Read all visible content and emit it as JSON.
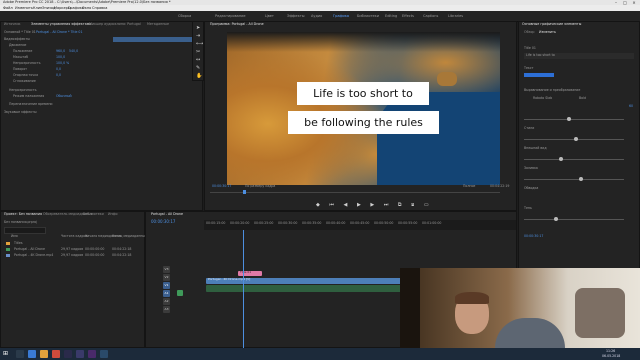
{
  "window": {
    "title": "Adobe Premiere Pro CC 2018 - C:\\Users\\...\\Documents\\Adobe\\Premiere Pro\\12.0\\Без названия *"
  },
  "menu": [
    "Файл",
    "Изменить",
    "Клип",
    "Эпизод",
    "Маркеры",
    "Графика",
    "Окно",
    "Справка"
  ],
  "workspaces": {
    "items": [
      "Сборка",
      "Редактирование",
      "Цвет",
      "Эффекты",
      "Аудио",
      "Графика",
      "Библиотеки",
      "Editing",
      "Effects",
      "Captions",
      "Libraries"
    ],
    "active_index": 5
  },
  "left_panel": {
    "tabs": [
      "Элементы управления эффектами",
      "Микшер аудиоклипа: Portugal",
      "Метаданные"
    ],
    "source": "Основной * Title 01",
    "clip": "Portugal - All Drone * Title 01",
    "section": "Видеоэффекты",
    "rows": [
      "Движение",
      "Положение",
      "Масштаб",
      "Непрозрачность",
      "Поворот",
      "Опорная точка",
      "Сглаживание",
      "Непрозрачность",
      "Режим наложения",
      "Переназначение времени",
      "Звуковые эффекты"
    ],
    "values": [
      "960,0",
      "540,0",
      "100,0",
      "100,0 %",
      "0,0",
      "0,0",
      "Обычный"
    ]
  },
  "program_monitor": {
    "tab": "Программа: Portugal - All Drone",
    "timecode_left": "00:00:30:17",
    "fit": "По размеру кадра",
    "quality": "Полное",
    "timecode_right": "00:04:22:19"
  },
  "lower_third": {
    "line1": "Life is too short to",
    "line2": "be following the rules"
  },
  "project_panel": {
    "tabs": [
      "Проект: Без названия",
      "Обозреватель медиаданных",
      "Библиотеки",
      "Инфо"
    ],
    "name": "Без названия.prproj",
    "columns": [
      "Имя",
      "Частота кадров",
      "Начало медиаданных",
      "Конец медиаданных"
    ],
    "items": [
      {
        "name": "Portugal - All Drone",
        "fps": "29,97 кадров",
        "start": "00:00:00:00",
        "end": "00:04:22:18"
      },
      {
        "name": "Portugal - 4K Drone.mp4",
        "fps": "29,97 кадров",
        "start": "00:00:00:00",
        "end": "00:04:22:18"
      },
      {
        "name": "Titles",
        "fps": "",
        "start": "",
        "end": ""
      }
    ]
  },
  "timeline": {
    "tab": "Portugal - All Drone",
    "timecode": "00:00:30:17",
    "ruler": [
      "00:00:15:00",
      "00:00:20:00",
      "00:00:25:00",
      "00:00:30:00",
      "00:00:35:00",
      "00:00:40:00",
      "00:00:45:00",
      "00:00:50:00",
      "00:00:55:00",
      "00:01:00:00"
    ],
    "tracks": [
      "V3",
      "V2",
      "V1",
      "A1",
      "A2",
      "A3"
    ],
    "clip_v2": "Title 01",
    "clip_v1": "Portugal - 4K Drone.mp4 [V]"
  },
  "essential_graphics": {
    "tabs": [
      "Основные графические элементы",
      "Обзор",
      "Изменить"
    ],
    "title": "Title 01",
    "layer": "Life is too short to",
    "section": "Текст",
    "font": "Roboto Slab",
    "style": "Bold",
    "size": "60",
    "labels": [
      "Выравнивание и преобразование",
      "Стили",
      "Внешний вид",
      "Заливка",
      "Обводка",
      "Тень"
    ],
    "timecode": "00:00:30:17"
  },
  "taskbar": {
    "clock": "11:26",
    "date": "06.05.2018"
  },
  "colors": {
    "accent": "#4d8fe0",
    "clip_v1": "#4d7fb8",
    "clip_title": "#e07aa7",
    "audio": "#3f9a5a"
  }
}
